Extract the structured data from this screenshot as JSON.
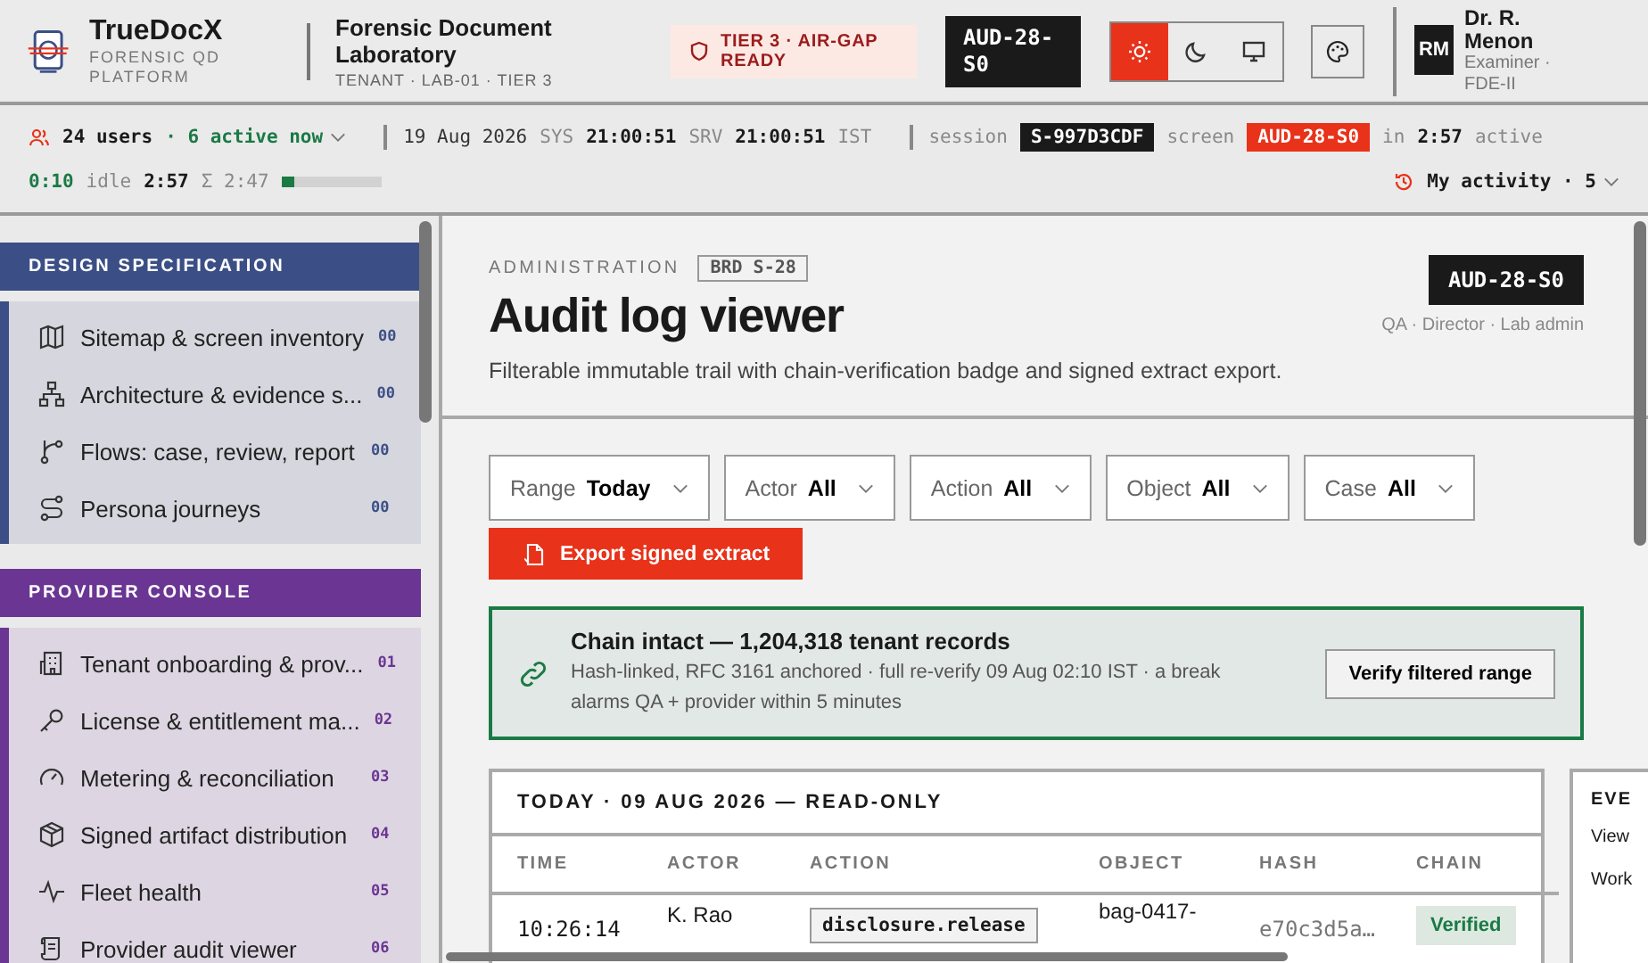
{
  "header": {
    "brand": "TrueDocX",
    "brand_sub": "FORENSIC QD PLATFORM",
    "lab_name": "Forensic Document Laboratory",
    "lab_sub": "TENANT · LAB-01 · TIER 3",
    "tier_badge": "TIER 3 · AIR-GAP READY",
    "screen_code": "AUD-28-S0",
    "theme_modes": [
      {
        "kind": "light",
        "selected": true
      },
      {
        "kind": "dark",
        "selected": false
      },
      {
        "kind": "system",
        "selected": false
      }
    ],
    "user": {
      "initials": "RM",
      "name": "Dr. R. Menon",
      "role": "Examiner · FDE-II"
    }
  },
  "status_bar": {
    "users": "24 users",
    "active_now": "· 6 active now",
    "date": "19 Aug 2026",
    "sys_label": "SYS",
    "sys_time": "21:00:51",
    "srv_label": "SRV",
    "srv_time": "21:00:51",
    "tz": "IST",
    "session_label": "session",
    "session_id": "S-997D3CDF",
    "screen_label": "screen",
    "screen_code": "AUD-28-S0",
    "in_label": "in",
    "in_time": "2:57",
    "active_label": "active",
    "active_time": "0:10",
    "idle_label": "idle",
    "idle_time": "2:57",
    "total": "Σ 2:47",
    "level": 0.12,
    "my_activity": "My activity · 5"
  },
  "sidebar": {
    "sections": [
      {
        "title": "DESIGN SPECIFICATION",
        "color": "#3b4f86",
        "items": [
          {
            "kind": "map",
            "label": "Sitemap & screen inventory",
            "count": "00"
          },
          {
            "kind": "hierarchy",
            "label": "Architecture & evidence s...",
            "count": "00"
          },
          {
            "kind": "flow",
            "label": "Flows: case, review, report",
            "count": "00"
          },
          {
            "kind": "route",
            "label": "Persona journeys",
            "count": "00"
          }
        ]
      },
      {
        "title": "PROVIDER CONSOLE",
        "color": "#6a3593",
        "items": [
          {
            "kind": "building",
            "label": "Tenant onboarding & prov...",
            "count": "01"
          },
          {
            "kind": "key",
            "label": "License & entitlement ma...",
            "count": "02"
          },
          {
            "kind": "gauge",
            "label": "Metering & reconciliation",
            "count": "03"
          },
          {
            "kind": "package",
            "label": "Signed artifact distribution",
            "count": "04"
          },
          {
            "kind": "pulse",
            "label": "Fleet health",
            "count": "05"
          },
          {
            "kind": "scroll",
            "label": "Provider audit viewer",
            "count": "06"
          }
        ]
      }
    ]
  },
  "page": {
    "eyebrow": "ADMINISTRATION",
    "tag": "BRD S-28",
    "title": "Audit log viewer",
    "description": "Filterable immutable trail with chain-verification badge and signed extract export.",
    "screen_code": "AUD-28-S0",
    "roles": "QA · Director · Lab admin"
  },
  "filters": [
    {
      "label": "Range",
      "value": "Today"
    },
    {
      "label": "Actor",
      "value": "All"
    },
    {
      "label": "Action",
      "value": "All"
    },
    {
      "label": "Object",
      "value": "All"
    },
    {
      "label": "Case",
      "value": "All"
    }
  ],
  "export_button": "Export signed extract",
  "chain_banner": {
    "title": "Chain intact — 1,204,318 tenant records",
    "detail": "Hash-linked, RFC 3161 anchored · full re-verify 09 Aug 02:10 IST · a break alarms QA + provider within 5 minutes",
    "button": "Verify filtered range"
  },
  "table": {
    "title": "TODAY · 09 AUG 2026 — READ-ONLY",
    "columns": [
      "TIME",
      "ACTOR",
      "ACTION",
      "OBJECT",
      "HASH",
      "CHAIN"
    ],
    "rows": [
      {
        "time": "10:26:14",
        "actor": "K. Rao",
        "action": "disclosure.release",
        "object": "bag-0417-",
        "hash": "e70c3d5a…",
        "chain": "Verified"
      }
    ]
  },
  "side_card": {
    "title": "EVE",
    "items": [
      "View",
      "Work"
    ]
  }
}
